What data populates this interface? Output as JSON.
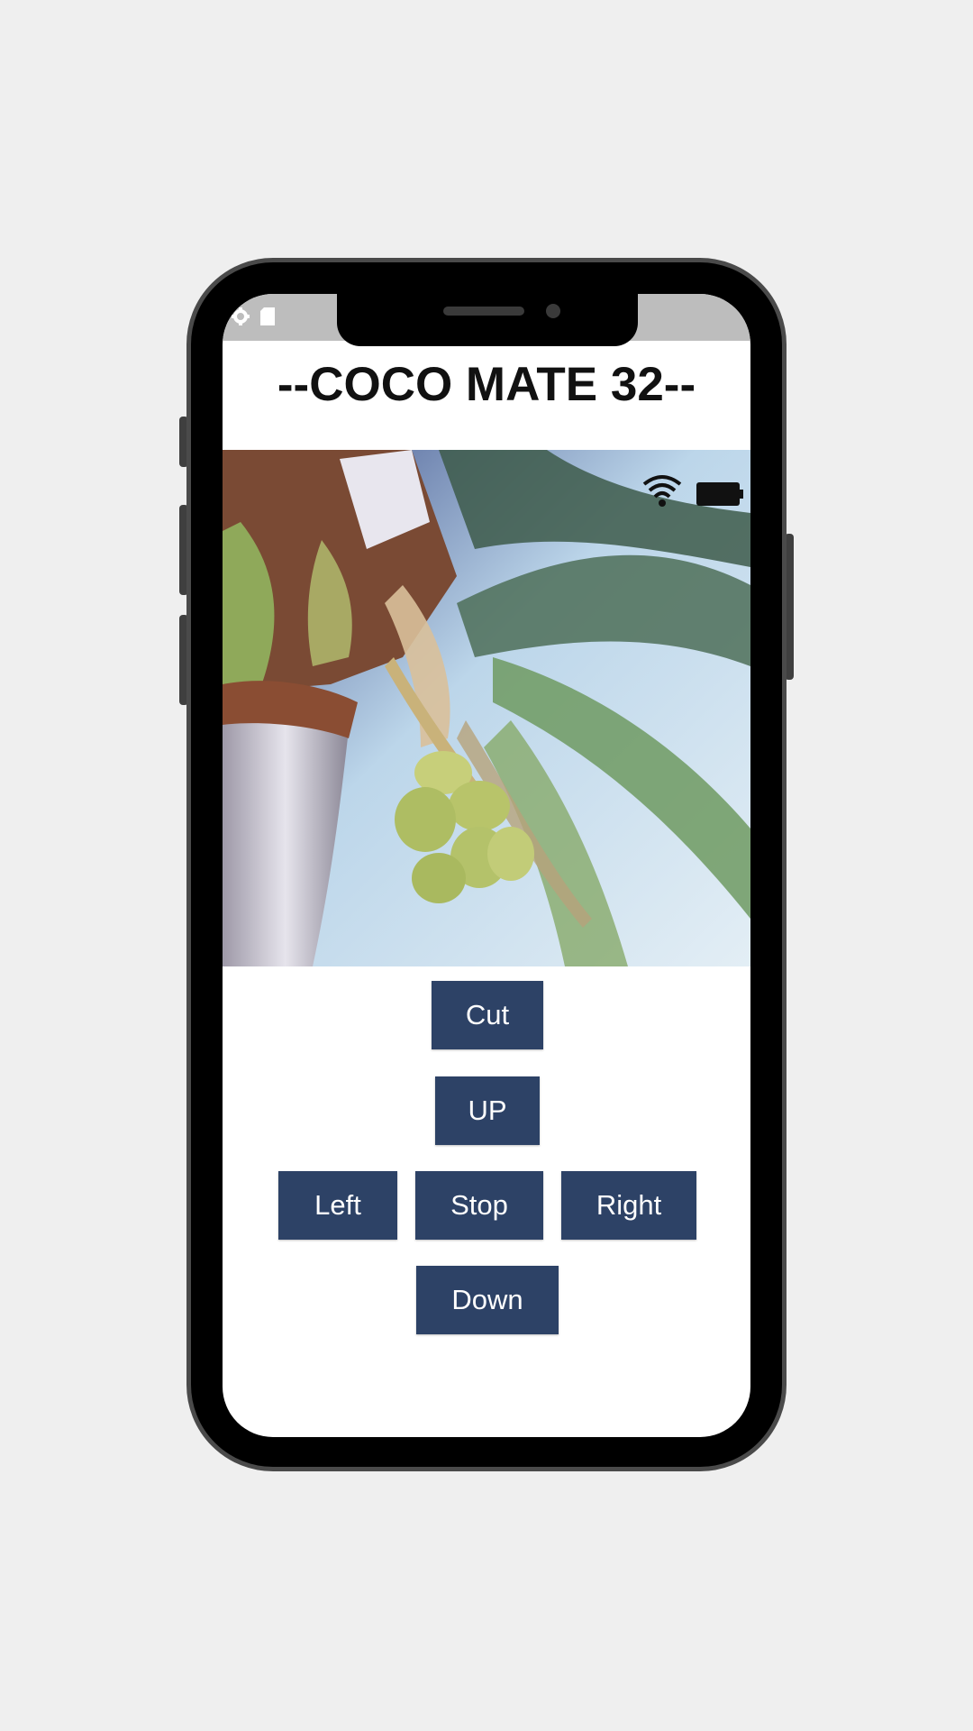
{
  "app": {
    "title": "--COCO MATE 32--"
  },
  "status_bar": {
    "icons": [
      "gear-icon",
      "sd-card-icon"
    ]
  },
  "camera_feed": {
    "overlay_icons": [
      "wifi-icon",
      "battery-icon"
    ]
  },
  "controls": {
    "cut": "Cut",
    "up": "UP",
    "left": "Left",
    "stop": "Stop",
    "right": "Right",
    "down": "Down"
  },
  "colors": {
    "button_bg": "#2d4266",
    "button_text": "#ffffff",
    "status_bar": "#bdbdbd",
    "page_bg": "#efefef"
  }
}
